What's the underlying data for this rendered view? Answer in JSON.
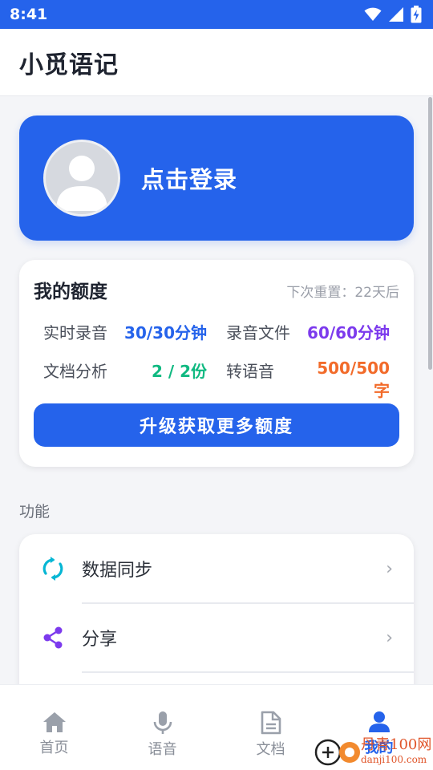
{
  "status_bar": {
    "time": "8:41",
    "icons": [
      "wifi-icon",
      "signal-icon",
      "battery-charging-icon"
    ]
  },
  "app": {
    "title": "小觅语记"
  },
  "login_card": {
    "text": "点击登录"
  },
  "quota": {
    "title": "我的额度",
    "reset": "下次重置：22天后",
    "items": [
      {
        "label": "实时录音",
        "value": "30/30分钟",
        "color": "#2563eb"
      },
      {
        "label": "录音文件",
        "value": "60/60分钟",
        "color": "#7c3aed"
      },
      {
        "label": "文档分析",
        "value": "2 / 2份",
        "color": "#10b981"
      },
      {
        "label": "转语音",
        "value": "500/500字",
        "color": "#f26b2a"
      }
    ],
    "upgrade_button": "升级获取更多额度"
  },
  "functions": {
    "section_label": "功能",
    "items": [
      {
        "label": "数据同步",
        "icon": "sync-icon",
        "icon_color": "#06b6d4",
        "chevron": "›"
      },
      {
        "label": "分享",
        "icon": "share-icon",
        "icon_color": "#7c3aed",
        "chevron": "›"
      }
    ]
  },
  "bottom_nav": {
    "items": [
      {
        "label": "首页",
        "icon": "home-icon"
      },
      {
        "label": "语音",
        "icon": "microphone-icon"
      },
      {
        "label": "文档",
        "icon": "document-icon"
      },
      {
        "label": "我的",
        "icon": "person-icon",
        "active": true
      }
    ]
  },
  "watermark": {
    "line1": "丹青100网",
    "line2": "danji100.com"
  }
}
